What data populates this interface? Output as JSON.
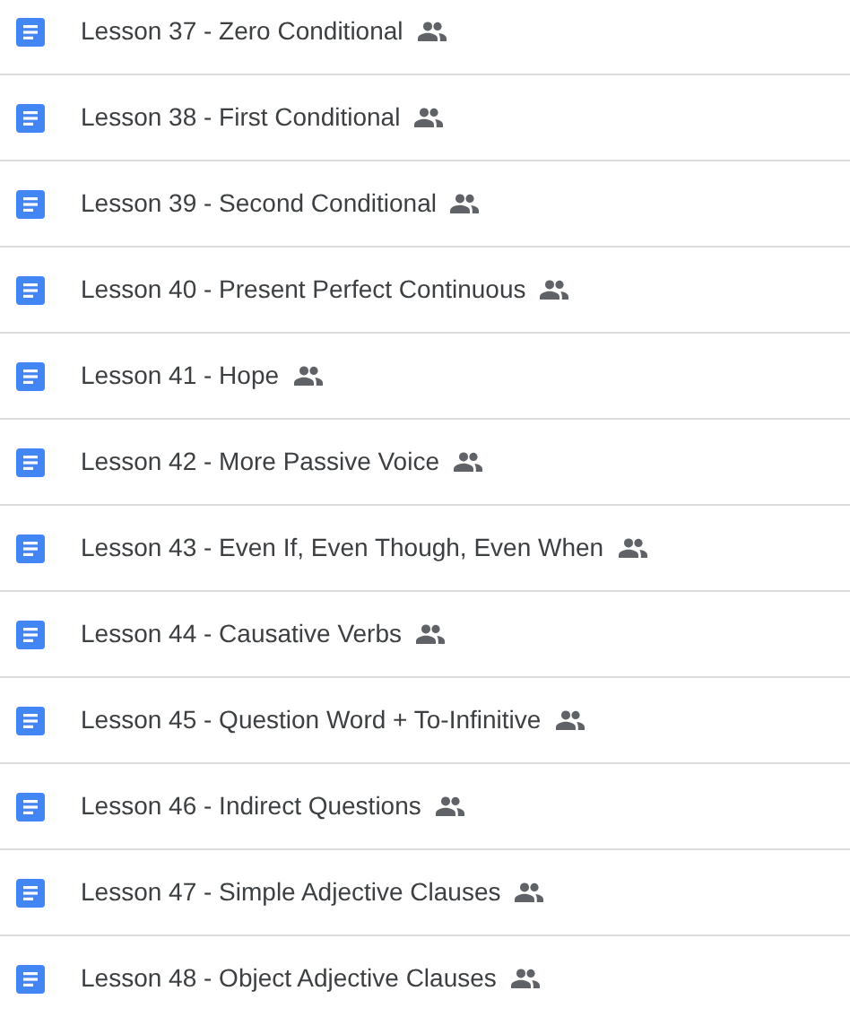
{
  "files": [
    {
      "name": "Lesson 37 - Zero Conditional",
      "shared": true
    },
    {
      "name": "Lesson 38 - First Conditional",
      "shared": true
    },
    {
      "name": "Lesson 39 - Second Conditional",
      "shared": true
    },
    {
      "name": "Lesson 40 - Present Perfect Continuous",
      "shared": true
    },
    {
      "name": "Lesson 41 - Hope",
      "shared": true
    },
    {
      "name": "Lesson 42 - More Passive Voice",
      "shared": true
    },
    {
      "name": "Lesson 43 - Even If, Even Though, Even When",
      "shared": true
    },
    {
      "name": "Lesson 44 - Causative Verbs",
      "shared": true
    },
    {
      "name": "Lesson 45 - Question Word + To-Infinitive",
      "shared": true
    },
    {
      "name": "Lesson 46 - Indirect Questions",
      "shared": true
    },
    {
      "name": "Lesson 47 - Simple Adjective Clauses",
      "shared": true
    },
    {
      "name": "Lesson 48 - Object Adjective Clauses",
      "shared": true
    }
  ]
}
